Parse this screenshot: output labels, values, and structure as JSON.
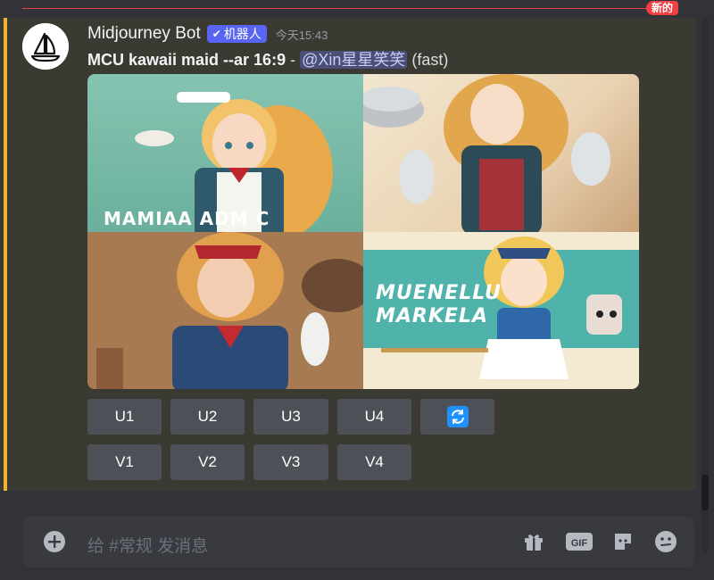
{
  "divider": {
    "badge": "新的"
  },
  "message": {
    "username": "Midjourney Bot",
    "bot_tag": "机器人",
    "timestamp": "今天15:43",
    "prompt": "MCU kawaii maid --ar 16:9",
    "separator": " - ",
    "mention": "@Xin星星笑笑",
    "speed": "(fast)",
    "image_text": {
      "tile1": "MAMIAA ADM C MMACCLL",
      "tile4_line1": "MUENELLU",
      "tile4_line2": "MARKELA"
    },
    "buttons_row1": [
      "U1",
      "U2",
      "U3",
      "U4"
    ],
    "buttons_row2": [
      "V1",
      "V2",
      "V3",
      "V4"
    ]
  },
  "input": {
    "placeholder": "给 #常规 发消息"
  },
  "colors": {
    "accent": "#5865f2",
    "highlight": "#f0b232",
    "new": "#f23f43",
    "refresh": "#1e90ff"
  },
  "icons": [
    "add-icon",
    "refresh-icon",
    "gift-icon",
    "gif-icon",
    "sticker-icon",
    "emoji-icon"
  ]
}
